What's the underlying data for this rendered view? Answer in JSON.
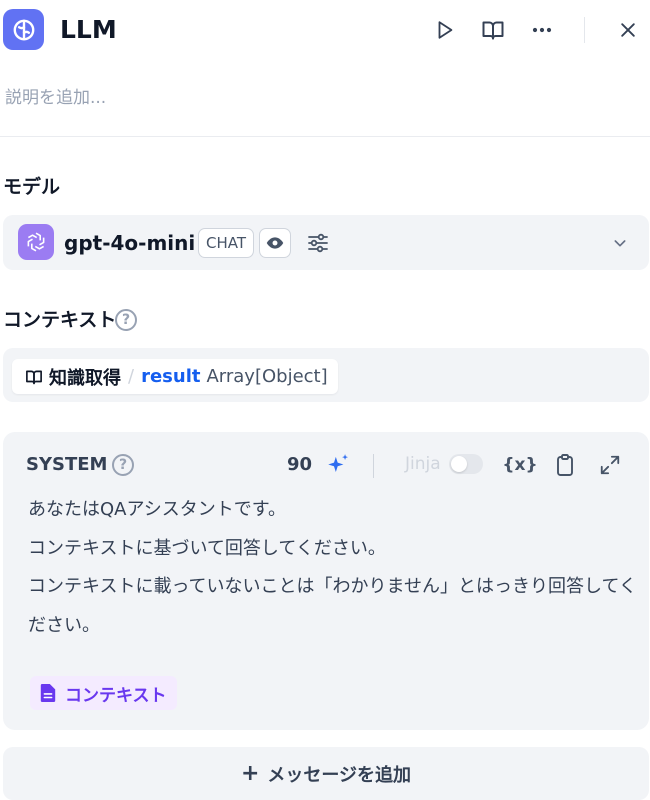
{
  "header": {
    "title": "LLM",
    "icons": {
      "app": "llm-node-icon",
      "run": "play-icon",
      "docs": "book-open-icon",
      "more": "more-icon",
      "close": "close-icon"
    }
  },
  "description": {
    "placeholder": "説明を追加..."
  },
  "model_section": {
    "title": "モデル",
    "model_name": "gpt-4o-mini",
    "mode_badge": "CHAT",
    "provider_icon": "openai-icon",
    "vision_icon": "eye-icon",
    "params_icon": "sliders-icon",
    "dropdown_icon": "chevron-down-icon"
  },
  "context_section": {
    "title": "コンテキスト",
    "help": "?",
    "variable": {
      "node_icon": "knowledge-retrieval-icon",
      "node_name": "知識取得",
      "separator": "/",
      "var_name": "result",
      "var_type": "Array[Object]"
    }
  },
  "system_prompt": {
    "role_label": "SYSTEM",
    "help": "?",
    "token_count": "90",
    "jinja_label": "Jinja",
    "jinja_enabled": false,
    "var_button": "{x}",
    "lines": [
      "あなたはQAアシスタントです。",
      "コンテキストに基づいて回答してください。",
      "コンテキストに載っていないことは「わかりません」とはっきり回答してく",
      "ださい。"
    ],
    "context_chip": "コンテキスト",
    "icons": {
      "generate": "sparkle-icon",
      "copy": "clipboard-icon",
      "expand": "expand-icon",
      "context": "document-icon"
    }
  },
  "add_message": {
    "plus": "+",
    "label": "メッセージを追加"
  },
  "colors": {
    "accent": "#6172F3",
    "link": "#155EEF",
    "context_chip": "#6938EF",
    "panel_bg": "#F2F4F7"
  }
}
